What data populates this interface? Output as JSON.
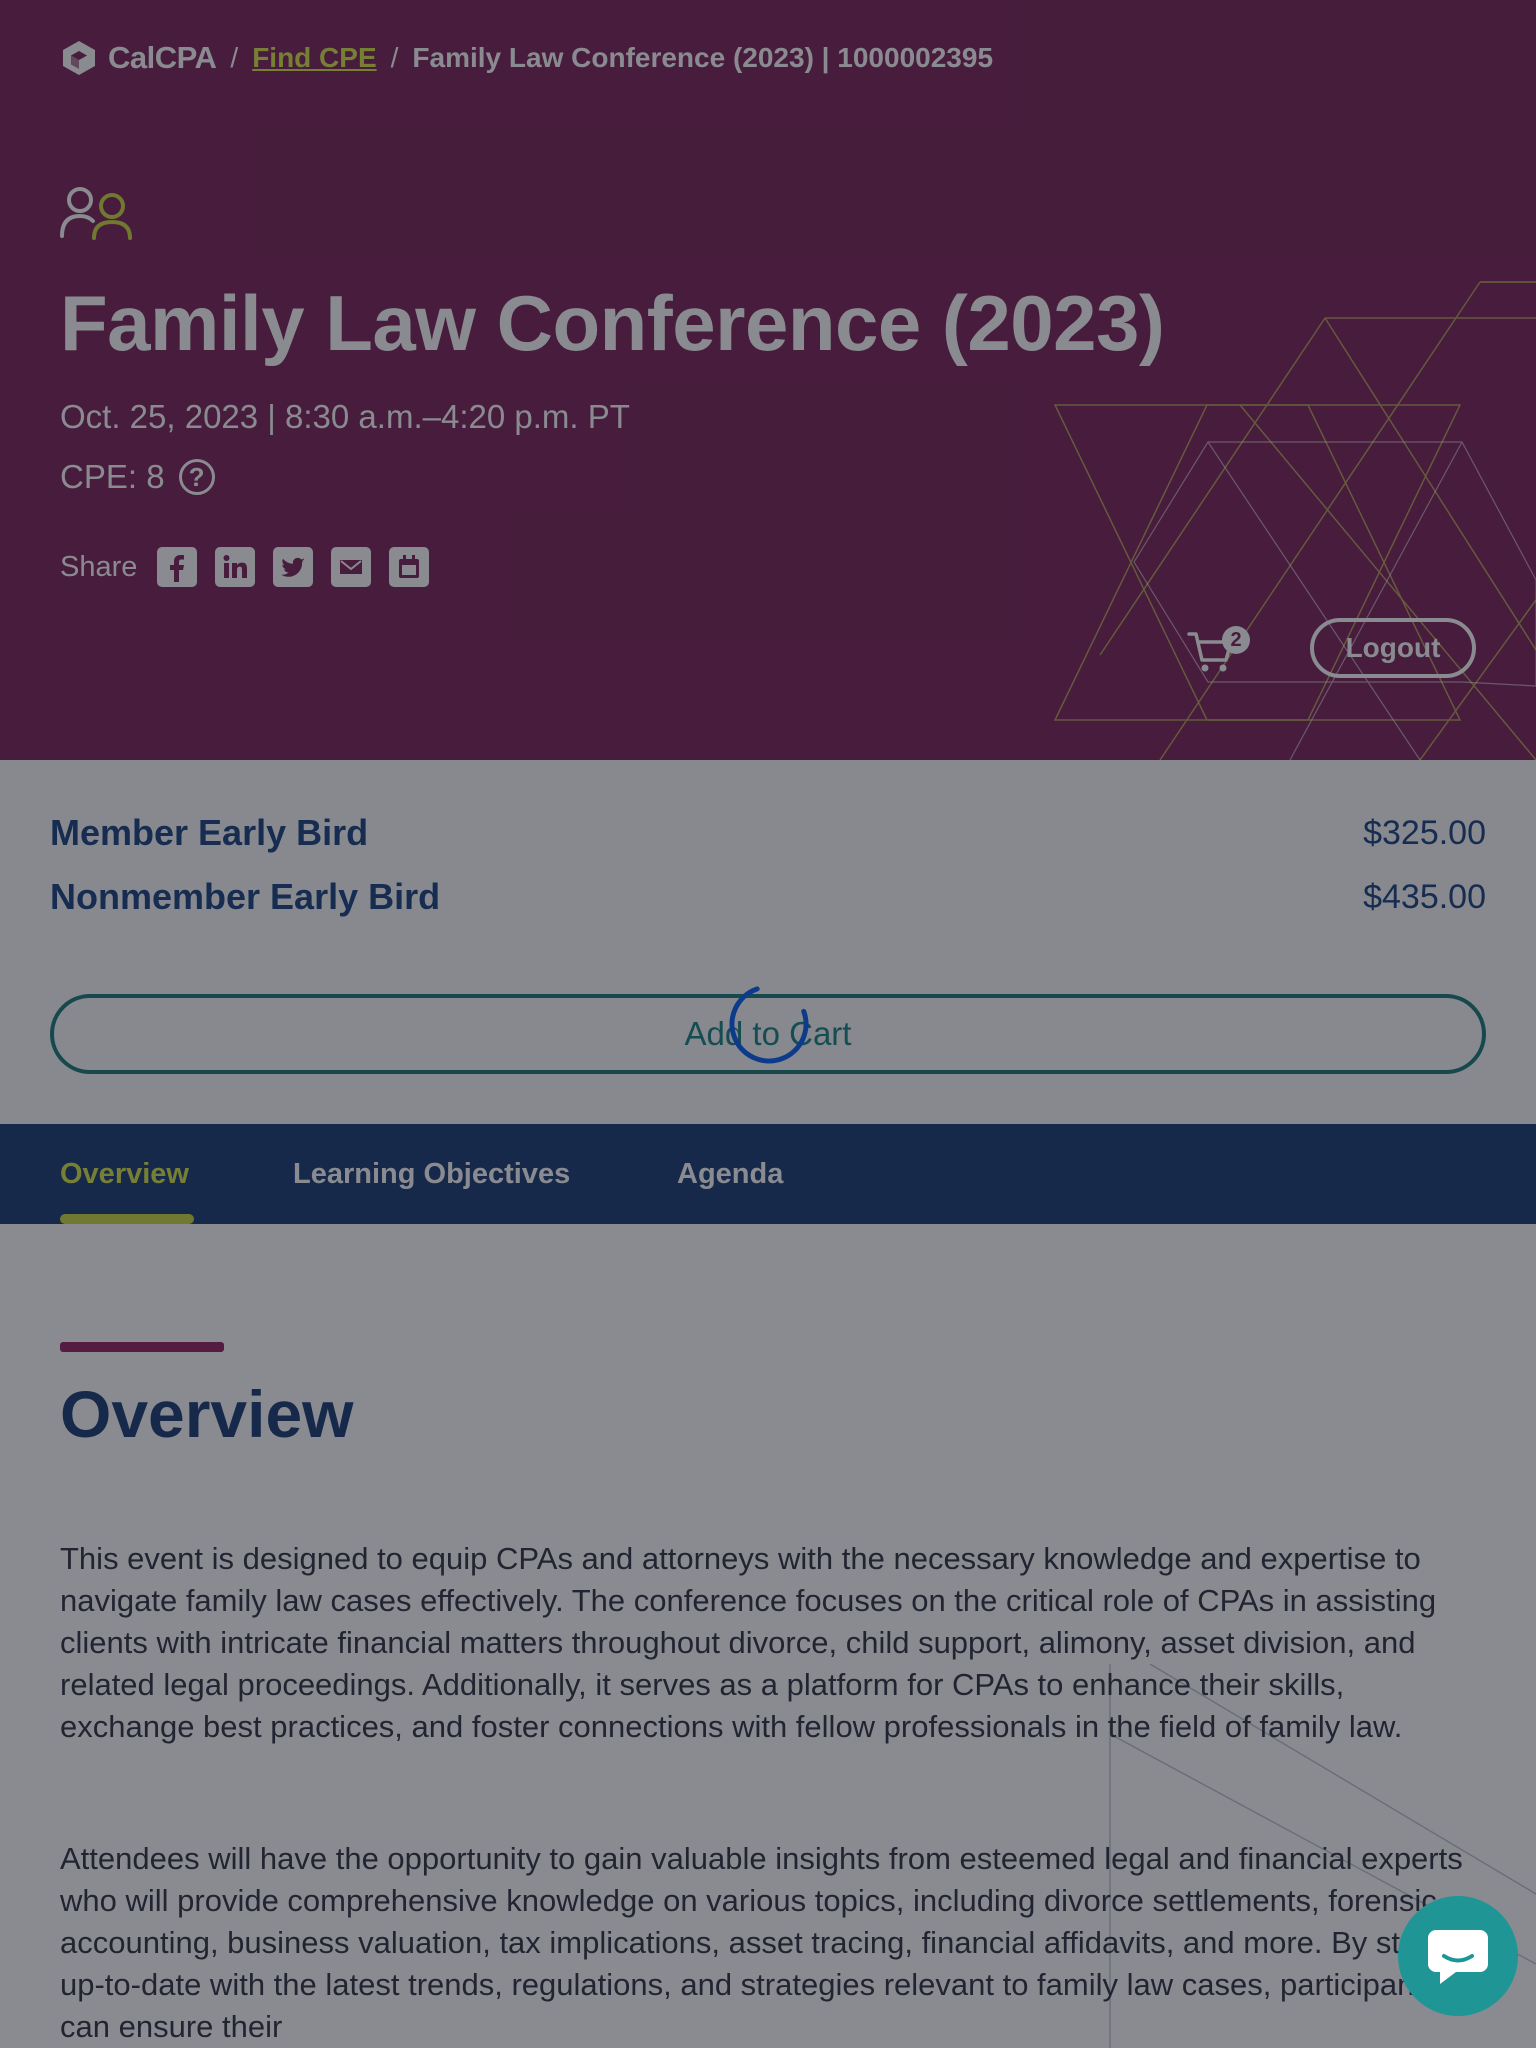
{
  "colors": {
    "hero_bg": "#6d0a45",
    "accent_lime": "#d8e437",
    "navy": "#002766",
    "teal": "#006d6d",
    "overlay": "rgba(40,44,52,0.55)"
  },
  "breadcrumb": {
    "logo_text": "CalCPA",
    "separator": "/",
    "link_label": "Find CPE",
    "current": "Family Law Conference (2023) | 1000002395"
  },
  "hero": {
    "category_icon": "people-icon",
    "title": "Family Law Conference (2023)",
    "date": "Oct. 25, 2023 | 8:30 a.m.–4:20 p.m. PT",
    "cpe_label": "CPE: 8",
    "cpe_help_icon": "question-icon",
    "share_label": "Share",
    "share_icons": [
      "facebook-icon",
      "linkedin-icon",
      "twitter-icon",
      "email-icon",
      "calendar-icon"
    ],
    "cart_count": "2",
    "logout_label": "Logout"
  },
  "pricing": {
    "rows": [
      {
        "name": "Member Early Bird",
        "price": "$325.00"
      },
      {
        "name": "Nonmember Early Bird",
        "price": "$435.00"
      }
    ],
    "add_to_cart_label": "Add to Cart"
  },
  "tabs": [
    {
      "label": "Overview",
      "active": true
    },
    {
      "label": "Learning Objectives",
      "active": false
    },
    {
      "label": "Agenda",
      "active": false
    }
  ],
  "overview": {
    "heading": "Overview",
    "paragraphs": [
      "This event is designed to equip CPAs and attorneys with the necessary knowledge and expertise to navigate family law cases effectively. The conference focuses on the critical role of CPAs in assisting clients with intricate financial matters throughout divorce, child support, alimony, asset division, and related legal proceedings. Additionally, it serves as a platform for CPAs to enhance their skills, exchange best practices, and foster connections with fellow professionals in the field of family law.",
      "Attendees will have the opportunity to gain valuable insights from esteemed legal and financial experts who will provide comprehensive knowledge on various topics, including divorce settlements, forensic accounting, business valuation, tax implications, asset tracing, financial affidavits, and more. By staying up-to-date with the latest trends, regulations, and strategies relevant to family law cases, participants can ensure their"
    ]
  },
  "chat": {
    "icon": "chat-bubble-icon"
  }
}
